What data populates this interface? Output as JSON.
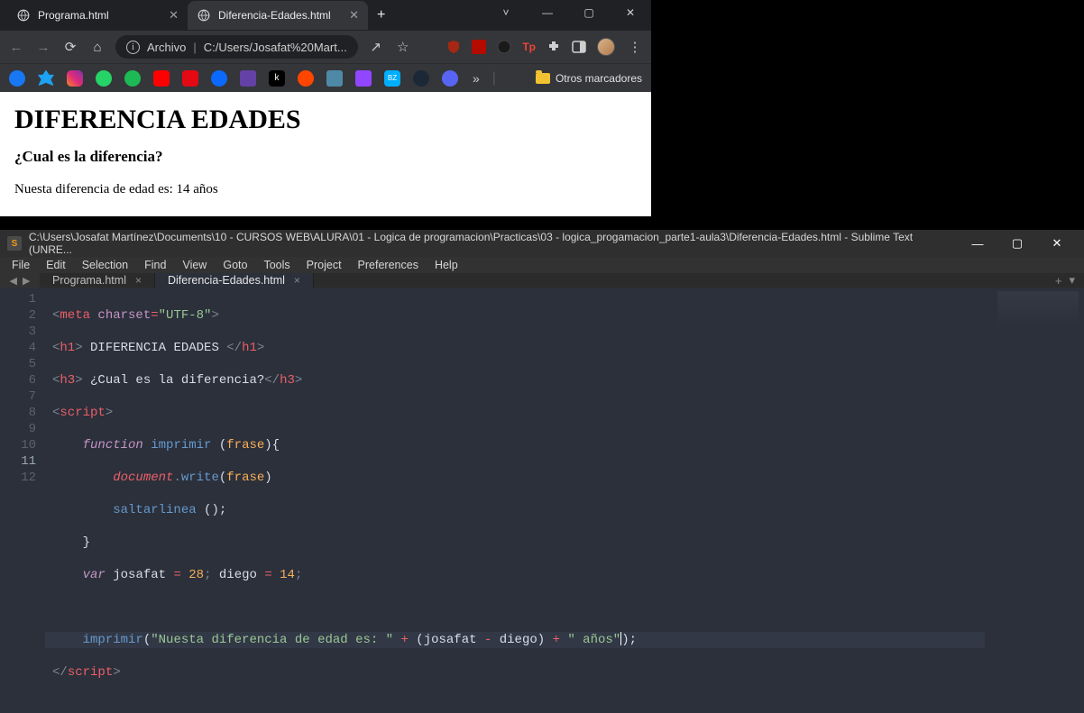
{
  "chrome": {
    "tabs": [
      {
        "title": "Programa.html",
        "active": false
      },
      {
        "title": "Diferencia-Edades.html",
        "active": true
      }
    ],
    "nav": {
      "back": "←",
      "forward": "→",
      "reload": "⟳",
      "home": "⌂"
    },
    "address": {
      "scheme_label": "Archivo",
      "url": "C:/Users/Josafat%20Mart..."
    },
    "share": "↗",
    "star": "☆",
    "ext_icons": [
      "ublock",
      "pdf",
      "dark",
      "tp",
      "puzzle",
      "panel",
      "avatar",
      "more"
    ],
    "bookmarks_bar": {
      "more": "»",
      "folder_label": "Otros marcadores"
    },
    "page": {
      "h1": "DIFERENCIA EDADES",
      "h3": "¿Cual es la diferencia?",
      "body": "Nuesta diferencia de edad es: 14 años"
    },
    "win": {
      "chev": "˅",
      "min": "—",
      "max": "▢",
      "close": "✕"
    }
  },
  "sublime": {
    "title": "C:\\Users\\Josafat Martínez\\Documents\\10 - CURSOS WEB\\ALURA\\01 - Logica de programacion\\Practicas\\03 - logica_progamacion_parte1-aula3\\Diferencia-Edades.html - Sublime Text (UNRE...",
    "win": {
      "min": "—",
      "max": "▢",
      "close": "✕"
    },
    "menu": [
      "File",
      "Edit",
      "Selection",
      "Find",
      "View",
      "Goto",
      "Tools",
      "Project",
      "Preferences",
      "Help"
    ],
    "nav": {
      "back": "◀",
      "fwd": "▶"
    },
    "tabs": [
      {
        "title": "Programa.html",
        "active": false,
        "close": "×"
      },
      {
        "title": "Diferencia-Edades.html",
        "active": true,
        "close": "×"
      }
    ],
    "tabs_right": {
      "plus": "+",
      "menu": "▾"
    },
    "lines": [
      "1",
      "2",
      "3",
      "4",
      "5",
      "6",
      "7",
      "8",
      "9",
      "10",
      "11",
      "12"
    ],
    "current_line_index": 10,
    "code": {
      "l1": {
        "tag": "meta",
        "attr": "charset",
        "eq": "=",
        "val": "\"UTF-8\""
      },
      "l2": {
        "tag": "h1",
        "text": " DIFERENCIA EDADES "
      },
      "l3": {
        "tag": "h3",
        "text": " ¿Cual es la diferencia?"
      },
      "l4": {
        "tag": "script"
      },
      "l5": {
        "kw": "function",
        "name": "imprimir",
        "p": "frase"
      },
      "l6": {
        "obj": "document",
        "m": "write",
        "p": "frase"
      },
      "l7": {
        "call": "saltarlinea"
      },
      "l9": {
        "kw": "var",
        "v1": "josafat",
        "n1": "28",
        "v2": "diego",
        "n2": "14"
      },
      "l11": {
        "call": "imprimir",
        "s1": "\"Nuesta diferencia de edad es: \"",
        "a": "josafat",
        "b": "diego",
        "s2": "\" años\""
      },
      "l12": {
        "tag": "script"
      }
    }
  }
}
